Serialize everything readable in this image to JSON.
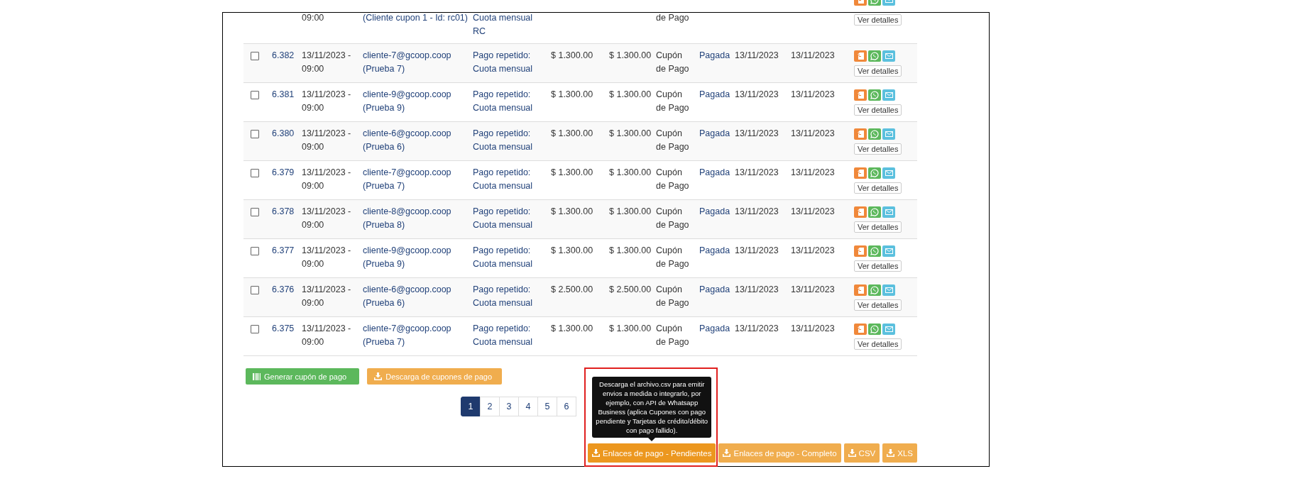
{
  "table": {
    "rows": [
      {
        "kind": "partial",
        "date_lines": [
          "09:00"
        ],
        "client_lines": [
          "(Cliente cupon 1 - Id: rc01)"
        ],
        "concept_lines": [
          "Cuota mensual",
          "RC"
        ],
        "method_lines": [
          "de Pago"
        ],
        "details": "Ver detalles"
      },
      {
        "kind": "full",
        "checked": false,
        "id": "6.382",
        "date_lines": [
          "13/11/2023 -",
          "09:00"
        ],
        "client_lines": [
          "cliente-7@gcoop.coop",
          "(Prueba 7)"
        ],
        "concept_lines": [
          "Pago repetido:",
          "Cuota mensual"
        ],
        "amount": "$ 1.300.00",
        "total": "$ 1.300.00",
        "method_lines": [
          "Cupón",
          "de Pago"
        ],
        "status": "Pagada",
        "date_paid": "13/11/2023",
        "date_due": "13/11/2023",
        "details": "Ver detalles"
      },
      {
        "kind": "full",
        "checked": false,
        "id": "6.381",
        "date_lines": [
          "13/11/2023 -",
          "09:00"
        ],
        "client_lines": [
          "cliente-9@gcoop.coop",
          "(Prueba 9)"
        ],
        "concept_lines": [
          "Pago repetido:",
          "Cuota mensual"
        ],
        "amount": "$ 1.300.00",
        "total": "$ 1.300.00",
        "method_lines": [
          "Cupón",
          "de Pago"
        ],
        "status": "Pagada",
        "date_paid": "13/11/2023",
        "date_due": "13/11/2023",
        "details": "Ver detalles"
      },
      {
        "kind": "full",
        "checked": false,
        "id": "6.380",
        "date_lines": [
          "13/11/2023 -",
          "09:00"
        ],
        "client_lines": [
          "cliente-6@gcoop.coop",
          "(Prueba 6)"
        ],
        "concept_lines": [
          "Pago repetido:",
          "Cuota mensual"
        ],
        "amount": "$ 1.300.00",
        "total": "$ 1.300.00",
        "method_lines": [
          "Cupón",
          "de Pago"
        ],
        "status": "Pagada",
        "date_paid": "13/11/2023",
        "date_due": "13/11/2023",
        "details": "Ver detalles"
      },
      {
        "kind": "full",
        "checked": false,
        "id": "6.379",
        "date_lines": [
          "13/11/2023 -",
          "09:00"
        ],
        "client_lines": [
          "cliente-7@gcoop.coop",
          "(Prueba 7)"
        ],
        "concept_lines": [
          "Pago repetido:",
          "Cuota mensual"
        ],
        "amount": "$ 1.300.00",
        "total": "$ 1.300.00",
        "method_lines": [
          "Cupón",
          "de Pago"
        ],
        "status": "Pagada",
        "date_paid": "13/11/2023",
        "date_due": "13/11/2023",
        "details": "Ver detalles"
      },
      {
        "kind": "full",
        "checked": false,
        "id": "6.378",
        "date_lines": [
          "13/11/2023 -",
          "09:00"
        ],
        "client_lines": [
          "cliente-8@gcoop.coop",
          "(Prueba 8)"
        ],
        "concept_lines": [
          "Pago repetido:",
          "Cuota mensual"
        ],
        "amount": "$ 1.300.00",
        "total": "$ 1.300.00",
        "method_lines": [
          "Cupón",
          "de Pago"
        ],
        "status": "Pagada",
        "date_paid": "13/11/2023",
        "date_due": "13/11/2023",
        "details": "Ver detalles"
      },
      {
        "kind": "full",
        "checked": false,
        "id": "6.377",
        "date_lines": [
          "13/11/2023 -",
          "09:00"
        ],
        "client_lines": [
          "cliente-9@gcoop.coop",
          "(Prueba 9)"
        ],
        "concept_lines": [
          "Pago repetido:",
          "Cuota mensual"
        ],
        "amount": "$ 1.300.00",
        "total": "$ 1.300.00",
        "method_lines": [
          "Cupón",
          "de Pago"
        ],
        "status": "Pagada",
        "date_paid": "13/11/2023",
        "date_due": "13/11/2023",
        "details": "Ver detalles"
      },
      {
        "kind": "full",
        "checked": false,
        "id": "6.376",
        "date_lines": [
          "13/11/2023 -",
          "09:00"
        ],
        "client_lines": [
          "cliente-6@gcoop.coop",
          "(Prueba 6)"
        ],
        "concept_lines": [
          "Pago repetido:",
          "Cuota mensual"
        ],
        "amount": "$ 2.500.00",
        "total": "$ 2.500.00",
        "method_lines": [
          "Cupón",
          "de Pago"
        ],
        "status": "Pagada",
        "date_paid": "13/11/2023",
        "date_due": "13/11/2023",
        "details": "Ver detalles"
      },
      {
        "kind": "full",
        "checked": false,
        "id": "6.375",
        "date_lines": [
          "13/11/2023 -",
          "09:00"
        ],
        "client_lines": [
          "cliente-7@gcoop.coop",
          "(Prueba 7)"
        ],
        "concept_lines": [
          "Pago repetido:",
          "Cuota mensual"
        ],
        "amount": "$ 1.300.00",
        "total": "$ 1.300.00",
        "method_lines": [
          "Cupón",
          "de Pago"
        ],
        "status": "Pagada",
        "date_paid": "13/11/2023",
        "date_due": "13/11/2023",
        "details": "Ver detalles"
      }
    ]
  },
  "actions": [
    {
      "kind": "generate",
      "label": "Generar cupón de pago"
    },
    {
      "kind": "download",
      "label": "Descarga de cupones de pago"
    }
  ],
  "pagination": [
    {
      "label": "1",
      "selected": true
    },
    {
      "label": "2",
      "selected": false
    },
    {
      "label": "3",
      "selected": false
    },
    {
      "label": "4",
      "selected": false
    },
    {
      "label": "5",
      "selected": false
    },
    {
      "label": "6",
      "selected": false
    }
  ],
  "exports": [
    {
      "label": "Enlaces de pago - Pendientes",
      "hovered": true,
      "highlighted": true,
      "tooltip": "Descarga el archivo.csv para emitir envios a medida o integrarlo, por ejemplo, con API de Whatsapp Business (aplica Cupones con pago pendiente y Tarjetas de crédito/débito con pago fallido)."
    },
    {
      "label": "Enlaces de pago - Completo",
      "hovered": false,
      "highlighted": false
    },
    {
      "label": "CSV",
      "hovered": false,
      "highlighted": false
    },
    {
      "label": "XLS",
      "hovered": false,
      "highlighted": false
    }
  ]
}
